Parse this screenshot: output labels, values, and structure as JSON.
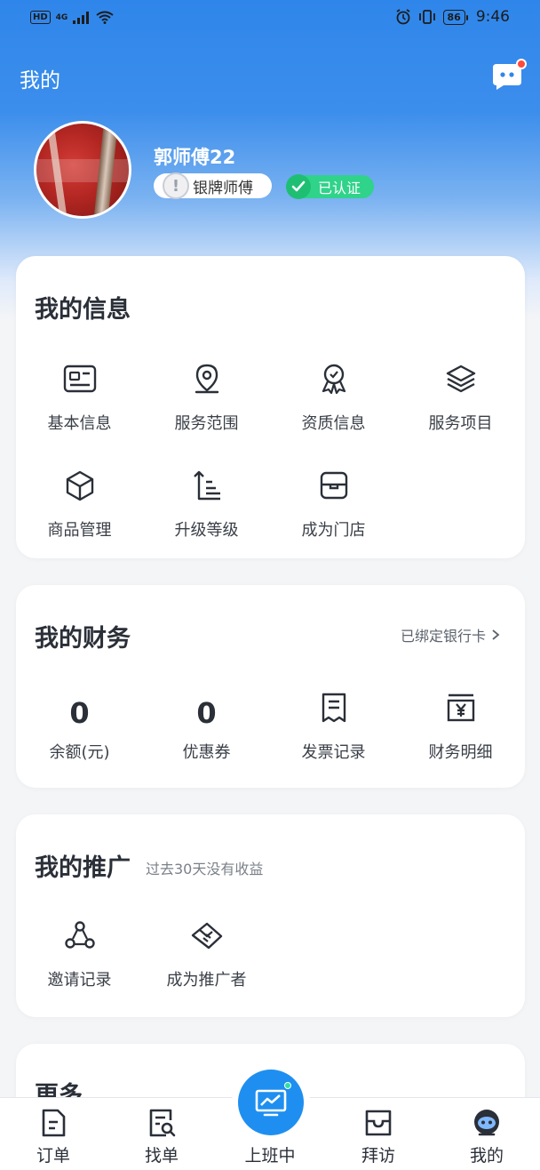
{
  "status_bar": {
    "hd": "HD",
    "network": "4G",
    "battery": "86",
    "time": "9:46"
  },
  "header": {
    "title": "我的"
  },
  "profile": {
    "name": "郭师傅22",
    "level": "银牌师傅",
    "verified": "已认证"
  },
  "my_info": {
    "title": "我的信息",
    "items": [
      {
        "label": "基本信息",
        "icon": "id-card-icon"
      },
      {
        "label": "服务范围",
        "icon": "location-pin-icon"
      },
      {
        "label": "资质信息",
        "icon": "award-icon"
      },
      {
        "label": "服务项目",
        "icon": "layers-icon"
      },
      {
        "label": "商品管理",
        "icon": "box-icon"
      },
      {
        "label": "升级等级",
        "icon": "level-up-icon"
      },
      {
        "label": "成为门店",
        "icon": "store-icon"
      }
    ]
  },
  "finance": {
    "title": "我的财务",
    "link": "已绑定银行卡",
    "items": [
      {
        "value": "0",
        "label": "余额(元)"
      },
      {
        "value": "0",
        "label": "优惠券"
      },
      {
        "label": "发票记录",
        "icon": "receipt-icon"
      },
      {
        "label": "财务明细",
        "icon": "yuan-bill-icon"
      }
    ]
  },
  "promotion": {
    "title": "我的推广",
    "subtitle": "过去30天没有收益",
    "items": [
      {
        "label": "邀请记录",
        "icon": "share-nodes-icon"
      },
      {
        "label": "成为推广者",
        "icon": "handshake-icon"
      }
    ]
  },
  "more": {
    "title": "更多"
  },
  "tabbar": {
    "items": [
      {
        "label": "订单",
        "icon": "order-icon"
      },
      {
        "label": "找单",
        "icon": "search-order-icon"
      },
      {
        "label": "上班中",
        "icon": "chart-icon"
      },
      {
        "label": "拜访",
        "icon": "inbox-icon"
      },
      {
        "label": "我的",
        "icon": "profile-icon"
      }
    ]
  },
  "colors": {
    "primary": "#1e8ff0",
    "verified": "#2fd38a",
    "badge_dot": "#ff4a3a"
  }
}
